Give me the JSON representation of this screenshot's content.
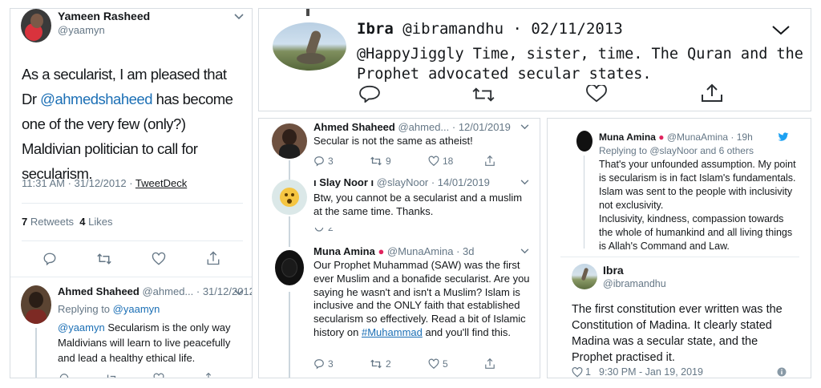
{
  "p1": {
    "author_name": "Yameen Rasheed",
    "author_handle": "@yaamyn",
    "text_before": "As a secularist, I am pleased that Dr ",
    "mention": "@ahmedshaheed",
    "text_after": " has become one of the very few (only?) Maldivian politician to call for secularism.",
    "timestamp": "11:31 AM · 31/12/2012 · ",
    "source": "TweetDeck",
    "retweets_count": "7",
    "retweets_label": "Retweets",
    "likes_count": "4",
    "likes_label": "Likes",
    "reply": {
      "name": "Ahmed Shaheed",
      "handle_date": "@ahmed... · 31/12/2012",
      "replying_to": "Replying to ",
      "replying_handle": "@yaamyn",
      "mention": "@yaamyn",
      "text": " Secularism is the only way Maldivians will learn to live peacefully and lead a healthy ethical life."
    }
  },
  "p2": {
    "name": "Ibra",
    "handle_date": "@ibramandhu · 02/11/2013",
    "text": "@HappyJiggly Time, sister, time. The Quran and the Prophet advocated secular states."
  },
  "p3": {
    "t1": {
      "name": "Ahmed Shaheed",
      "handle_date": "@ahmed... · 12/01/2019",
      "text": "Secular is not the same as atheist!",
      "replies": "3",
      "retweets": "9",
      "likes": "18"
    },
    "t2": {
      "name": "ı Slay Noor ı",
      "handle_date": "@slayNoor · 14/01/2019",
      "text": "Btw, you cannot be a secularist and a muslim at the same time. Thanks.",
      "replies": "2"
    },
    "t3": {
      "name": "Muna Amina",
      "handle_date": "@MunaAmina · 3d",
      "text_before": "Our Prophet Muhammad (SAW) was the first ever Muslim and a bonafide secularist. Are you saying he wasn't and isn't a Muslim? Islam is inclusive and the ONLY faith that established secularism so effectively. Read a bit of Islamic history on ",
      "hashtag": "#Muhammad",
      "text_after": " and you'll find this.",
      "replies": "3",
      "retweets": "2",
      "likes": "5"
    }
  },
  "p4": {
    "name": "Muna Amina",
    "handle_time": "@MunaAmina · 19h",
    "replying": "Replying to @slayNoor and 6 others",
    "text1": "That's your unfounded assumption. My point is secularism is in fact Islam's fundamentals. Islam was sent to the people with inclusivity not exclusivity.",
    "text2": "Inclusivity, kindness, compassion towards the whole of humankind and all living things is Allah's Command and Law.",
    "reply_name": "Ibra",
    "reply_handle": "@ibramandhu",
    "reply_text": "The first constitution ever written was the Constitution of Madina. It clearly stated Madina was a secular state, and the Prophet practised it.",
    "likes": "1",
    "timestamp": "9:30 PM - Jan 19, 2019"
  },
  "colors": {
    "link": "#1b6fb5",
    "twitter_blue": "#1da1f2",
    "muted": "#657786"
  }
}
